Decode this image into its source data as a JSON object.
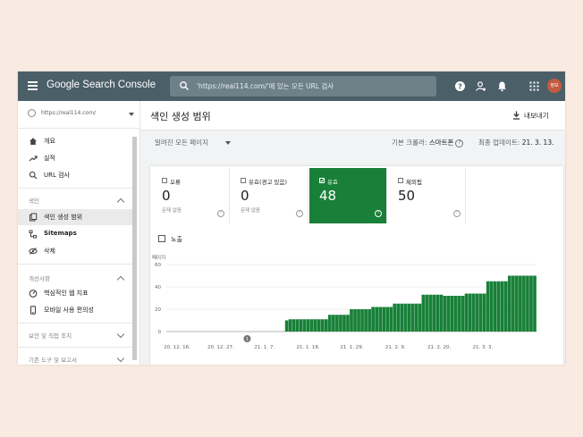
{
  "app": {
    "brand": "Google Search Console",
    "avatar_text": "정보"
  },
  "search": {
    "placeholder": "'https://real114.com/'에 있는 모든 URL 검사"
  },
  "sidebar": {
    "property": "https://real114.com/",
    "items": [
      {
        "label": "개요",
        "icon": "home-icon"
      },
      {
        "label": "실적",
        "icon": "trending-icon"
      },
      {
        "label": "URL 검사",
        "icon": "search-icon"
      }
    ],
    "section_index": "색인",
    "index_items": [
      {
        "label": "색인 생성 범위",
        "icon": "coverage-icon",
        "active": true
      },
      {
        "label": "Sitemaps",
        "icon": "sitemap-icon"
      },
      {
        "label": "삭제",
        "icon": "removal-icon"
      }
    ],
    "section_enhance": "개선사항",
    "enhance_items": [
      {
        "label": "핵심적인 웹 지표",
        "icon": "gauge-icon"
      },
      {
        "label": "모바일 사용 편의성",
        "icon": "mobile-icon"
      }
    ],
    "section_security": "보안 및 직접 조치",
    "section_legacy": "기존 도구 및 보고서"
  },
  "header": {
    "title": "색인 생성 범위",
    "export_label": "내보내기"
  },
  "filter": {
    "selected": "알려진 모든 페이지",
    "crawler_label": "기본 크롤러:",
    "crawler_value": "스마트폰",
    "updated_label": "최종 업데이트:",
    "updated_value": "21. 3. 13."
  },
  "stats": [
    {
      "label": "오류",
      "value": "0",
      "sub": "문제 없음"
    },
    {
      "label": "유효(경고 있음)",
      "value": "0",
      "sub": "문제 없음"
    },
    {
      "label": "유효",
      "value": "48",
      "sub": "",
      "selected": true
    },
    {
      "label": "제외됨",
      "value": "50",
      "sub": ""
    }
  ],
  "impressions_label": "노출",
  "colors": {
    "topbar": "#4b5f68",
    "valid_green": "#188038"
  },
  "chart_data": {
    "type": "bar",
    "ylabel": "페이지",
    "ylim": [
      0,
      60
    ],
    "yticks": [
      0,
      20,
      40,
      60
    ],
    "xtick_labels": [
      "20. 12. 16.",
      "20. 12. 27.",
      "21. 1. 7.",
      "21. 1. 18.",
      "21. 1. 29.",
      "21. 2. 9.",
      "21. 2. 20.",
      "21. 3. 3."
    ],
    "annotation": {
      "label": "1",
      "x_index": 22
    },
    "values": [
      0,
      0,
      0,
      0,
      0,
      0,
      0,
      0,
      0,
      0,
      0,
      0,
      0,
      0,
      0,
      0,
      0,
      0,
      0,
      0,
      0,
      0,
      0,
      0,
      0,
      0,
      0,
      0,
      0,
      0,
      0,
      0,
      0,
      10,
      11,
      11,
      11,
      11,
      11,
      11,
      11,
      11,
      11,
      11,
      11,
      15,
      15,
      15,
      15,
      15,
      15,
      20,
      20,
      20,
      20,
      20,
      20,
      22,
      22,
      22,
      22,
      22,
      22,
      25,
      25,
      25,
      25,
      25,
      25,
      25,
      25,
      33,
      33,
      33,
      33,
      33,
      33,
      32,
      32,
      32,
      32,
      32,
      32,
      34,
      34,
      34,
      34,
      34,
      34,
      45,
      45,
      45,
      45,
      45,
      45,
      50,
      50,
      50,
      50,
      50,
      50,
      50,
      50
    ]
  }
}
